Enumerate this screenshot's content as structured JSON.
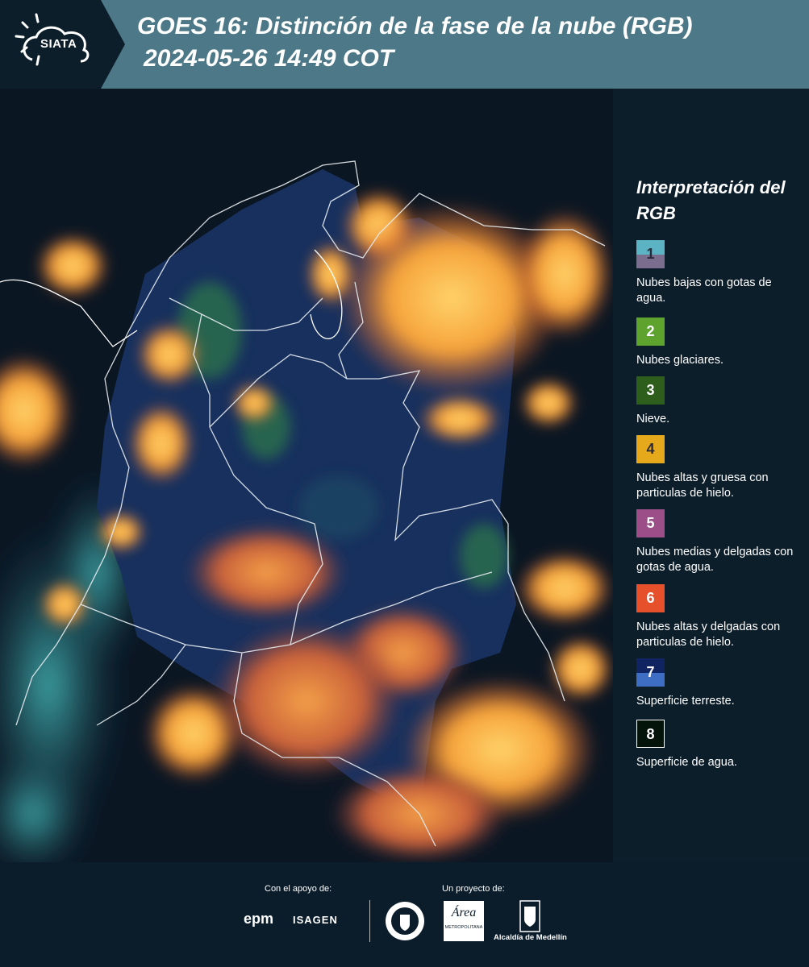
{
  "header": {
    "logo_text": "SIATA",
    "title": "GOES 16: Distinción de la fase de la nube (RGB)",
    "datetime": "2024-05-26 14:49 COT"
  },
  "legend": {
    "title": "Interpretación del RGB",
    "items": [
      {
        "number": "1",
        "label": "Nubes bajas con gotas de agua.",
        "color_top": "#5cb3c4",
        "color_bottom": "#7b6d8e"
      },
      {
        "number": "2",
        "label": "Nubes glaciares.",
        "color_top": "#5da32d",
        "color_bottom": "#5da32d"
      },
      {
        "number": "3",
        "label": "Nieve.",
        "color_top": "#2d5e1c",
        "color_bottom": "#2d5e1c"
      },
      {
        "number": "4",
        "label": "Nubes altas y gruesa con particulas de hielo.",
        "color_top": "#e7a91c",
        "color_bottom": "#e7a91c"
      },
      {
        "number": "5",
        "label": "Nubes medias y delgadas con gotas de agua.",
        "color_top": "#9b4e87",
        "color_bottom": "#9b4e87"
      },
      {
        "number": "6",
        "label": "Nubes altas y delgadas con particulas de hielo.",
        "color_top": "#e6512c",
        "color_bottom": "#e6512c"
      },
      {
        "number": "7",
        "label": "Superficie terreste.",
        "color_top": "#0f2461",
        "color_bottom": "#3e6dc4"
      },
      {
        "number": "8",
        "label": "Superficie de agua.",
        "color_top": "#04140a",
        "color_bottom": "#04140a"
      }
    ]
  },
  "footer": {
    "support_label": "Con el apoyo de:",
    "project_label": "Un proyecto de:",
    "sponsor_epm": "epm",
    "sponsor_isagen": "ISAGEN",
    "area_text": "Área",
    "area_sub": "METROPOLITANA",
    "alcaldia": "Alcaldía de Medellín"
  },
  "colors": {
    "header_bg": "#4d7887",
    "panel_bg": "#0d1e2b",
    "cloud_orange": "#f4a53a",
    "land_blue": "#17305e"
  }
}
